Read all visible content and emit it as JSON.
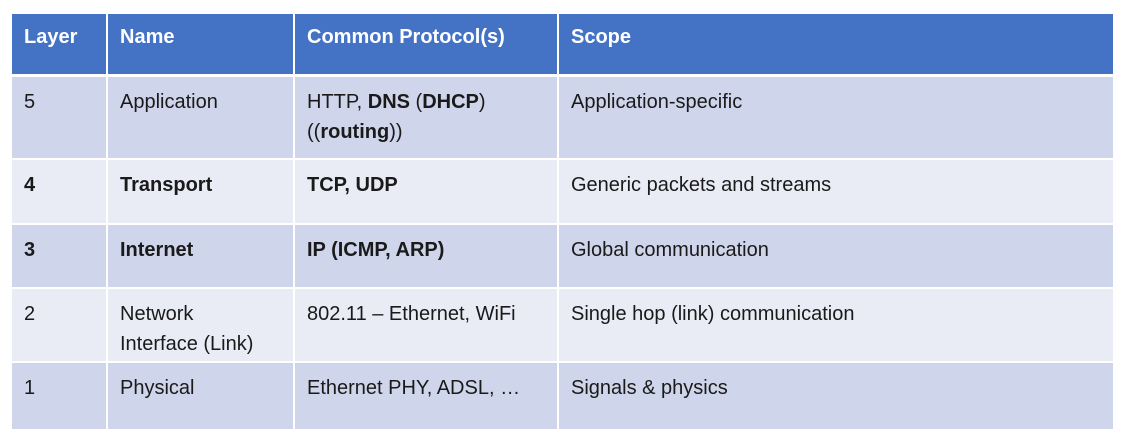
{
  "headers": {
    "layer": "Layer",
    "name": "Name",
    "protocols": "Common Protocol(s)",
    "scope": "Scope"
  },
  "rows": [
    {
      "layer": "5",
      "name": "Application",
      "protocols": {
        "p1": "HTTP, ",
        "p2": "DNS",
        "p3": " (",
        "p4": "DHCP",
        "p5": ")",
        "p6": "((",
        "p7": "routing",
        "p8": "))"
      },
      "scope": "Application-specific"
    },
    {
      "layer": "4",
      "name": "Transport",
      "protocols": "TCP, UDP",
      "scope": "Generic packets and streams"
    },
    {
      "layer": "3",
      "name": "Internet",
      "protocols": "IP (ICMP, ARP)",
      "scope": "Global communication"
    },
    {
      "layer": "2",
      "name_line1": "Network",
      "name_line2": "Interface (Link)",
      "protocols": "802.11 – Ethernet, WiFi",
      "scope": "Single hop (link) communication"
    },
    {
      "layer": "1",
      "name": "Physical",
      "protocols": "Ethernet PHY, ADSL, …",
      "scope": "Signals & physics"
    }
  ],
  "colors": {
    "header_bg": "#4472c4",
    "row_dark": "#cfd5ea",
    "row_light": "#e9ebf5"
  }
}
